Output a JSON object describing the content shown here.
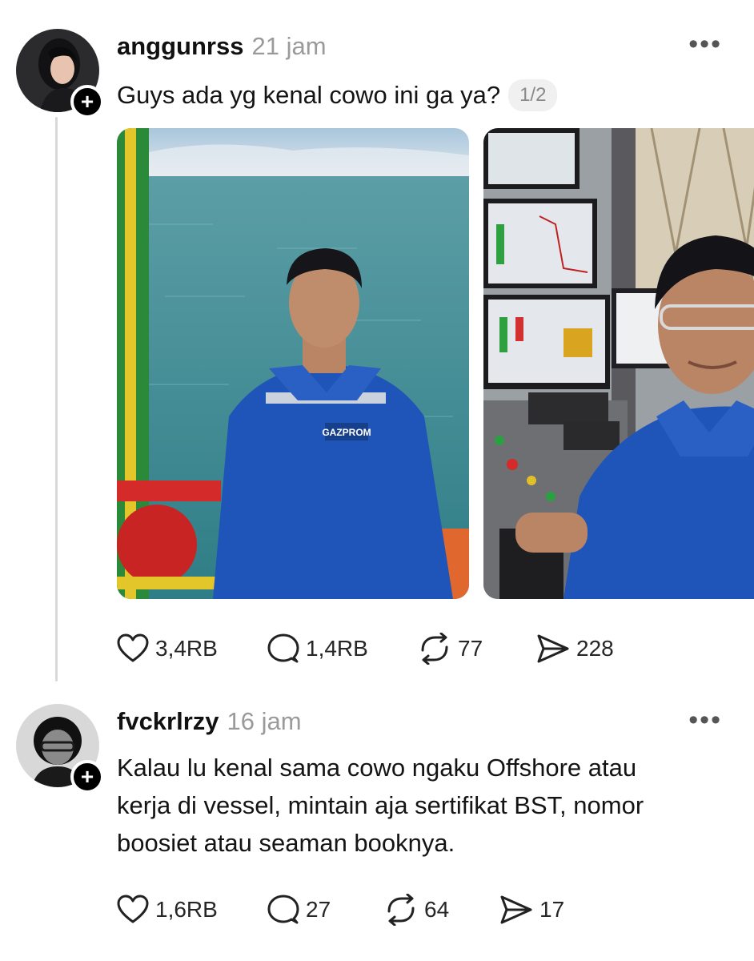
{
  "posts": [
    {
      "username": "anggunrss",
      "time": "21 jam",
      "text": "Guys ada yg kenal cowo ini ga ya?",
      "pager": "1/2",
      "more_label": "•••",
      "follow_label": "+",
      "photo_1_badge": "GAZPROM",
      "actions": {
        "likes": "3,4RB",
        "replies": "1,4RB",
        "reposts": "77",
        "shares": "228"
      }
    },
    {
      "username": "fvckrlrzy",
      "time": "16 jam",
      "text_lines": [
        "Kalau lu kenal sama cowo ngaku Offshore atau",
        "kerja di vessel, mintain aja sertifikat BST, nomor",
        "boosiet atau seaman booknya."
      ],
      "more_label": "•••",
      "follow_label": "+",
      "actions": {
        "likes": "1,6RB",
        "replies": "27",
        "reposts": "64",
        "shares": "17"
      }
    }
  ],
  "icons": [
    "heart-icon",
    "comment-icon",
    "repost-icon",
    "share-icon",
    "more-icon",
    "plus-icon"
  ],
  "colors": {
    "accent": "#000000",
    "muted": "#9a9a9a",
    "uniform_blue": "#1f55b8",
    "sea": "#4f9a9e"
  }
}
